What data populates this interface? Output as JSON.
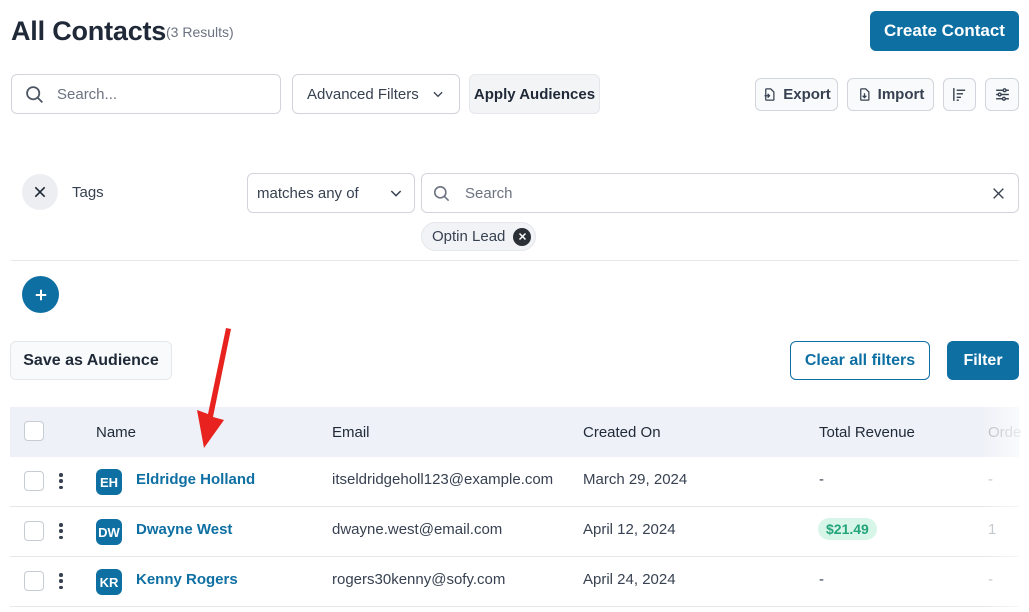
{
  "header": {
    "title": "All Contacts",
    "result_count": "(3 Results)",
    "create_label": "Create Contact"
  },
  "toolbar": {
    "search_placeholder": "Search...",
    "advanced_filters_label": "Advanced Filters",
    "apply_audiences_label": "Apply Audiences",
    "export_label": "Export",
    "import_label": "Import"
  },
  "filter": {
    "field_label": "Tags",
    "operator": "matches any of",
    "search_placeholder": "Search",
    "selected_tags": [
      "Optin Lead"
    ]
  },
  "actions": {
    "save_audience_label": "Save as Audience",
    "clear_filters_label": "Clear all filters",
    "filter_label": "Filter"
  },
  "table": {
    "columns": [
      "Name",
      "Email",
      "Created On",
      "Total Revenue",
      "Orde"
    ],
    "rows": [
      {
        "initials": "EH",
        "name": "Eldridge Holland",
        "email": "itseldridgeholl123@example.com",
        "created": "March 29, 2024",
        "revenue": "-",
        "orders": "-"
      },
      {
        "initials": "DW",
        "name": "Dwayne West",
        "email": "dwayne.west@email.com",
        "created": "April 12, 2024",
        "revenue": "$21.49",
        "orders": "1"
      },
      {
        "initials": "KR",
        "name": "Kenny Rogers",
        "email": "rogers30kenny@sofy.com",
        "created": "April 24, 2024",
        "revenue": "-",
        "orders": "-"
      }
    ]
  },
  "colors": {
    "primary": "#0e6fa3",
    "revenue_badge_bg": "#d8f5ea",
    "revenue_badge_text": "#24a47a",
    "annotation_arrow": "#e8231f"
  },
  "icons": {
    "search": "search-icon",
    "chevron": "chevron-down-icon",
    "export": "export-icon",
    "import": "import-icon",
    "sort": "sort-icon",
    "settings": "sliders-icon",
    "close": "close-icon",
    "add": "plus-icon"
  }
}
